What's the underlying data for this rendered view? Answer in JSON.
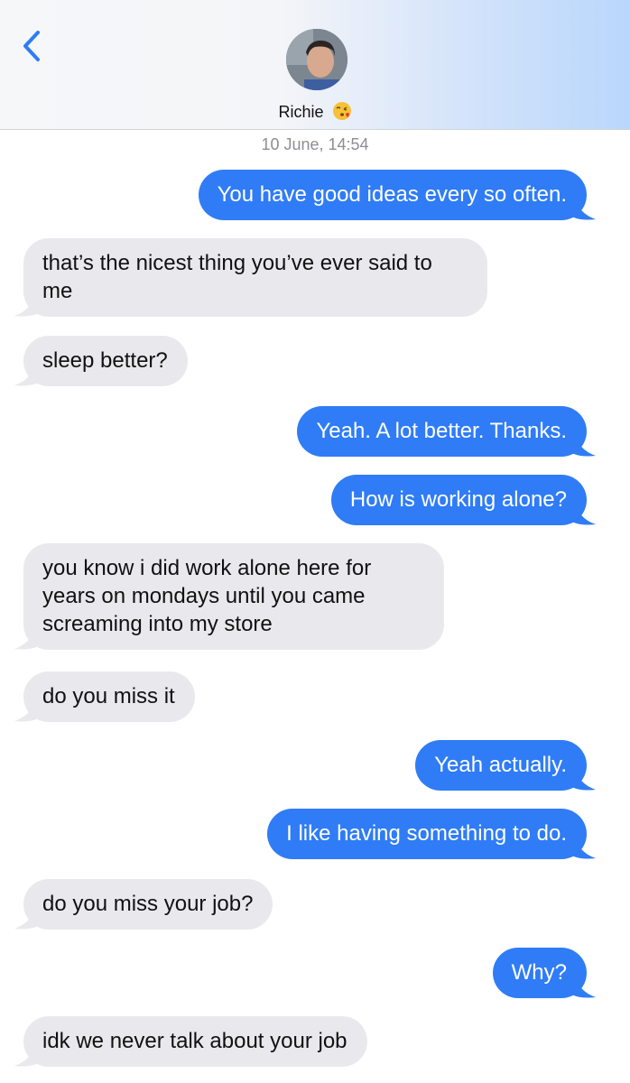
{
  "header": {
    "contact_name": "Richie",
    "emoji": "kissing-face-emoji",
    "back_icon": "chevron-left-icon"
  },
  "timestamp": "10 June, 14:54",
  "colors": {
    "sent_bubble": "#2f7cf6",
    "received_bubble": "#e9e9ed",
    "accent": "#2f7cf6"
  },
  "messages": [
    {
      "from": "me",
      "text": "You have good ideas every so often."
    },
    {
      "from": "them",
      "text": "that’s the nicest thing you’ve ever said to me"
    },
    {
      "from": "them",
      "text": "sleep better?"
    },
    {
      "from": "me",
      "text": "Yeah. A lot better. Thanks."
    },
    {
      "from": "me",
      "text": "How is working alone?"
    },
    {
      "from": "them",
      "text": "you know i did work alone here for years on mondays until you came screaming into my store"
    },
    {
      "from": "them",
      "text": "do you miss it"
    },
    {
      "from": "me",
      "text": "Yeah actually."
    },
    {
      "from": "me",
      "text": "I like having something to do."
    },
    {
      "from": "them",
      "text": "do you miss your job?"
    },
    {
      "from": "me",
      "text": "Why?"
    },
    {
      "from": "them",
      "text": "idk we never talk about your job"
    }
  ]
}
